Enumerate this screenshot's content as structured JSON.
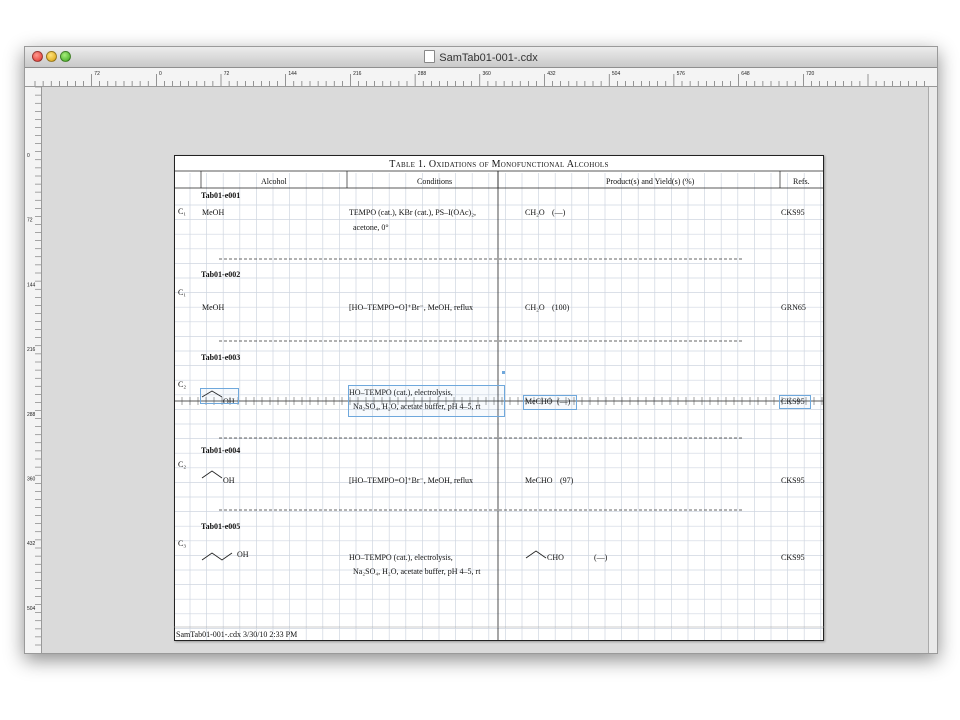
{
  "window": {
    "title": "SamTab01-001-.cdx",
    "doc_icon": "document-icon"
  },
  "rulers": {
    "horizontal_labels": [
      "72",
      "0",
      "72",
      "144",
      "216",
      "288",
      "360",
      "432",
      "504",
      "576",
      "648",
      "720"
    ],
    "vertical_labels": [
      "0",
      "72",
      "144",
      "216",
      "288",
      "360",
      "432",
      "504",
      "576"
    ]
  },
  "table": {
    "title": "Table 1. Oxidations of Monofunctional Alcohols",
    "headers": {
      "alcohol": "Alcohol",
      "conditions": "Conditions",
      "products": "Product(s) and Yield(s) (%)",
      "refs": "Refs."
    },
    "entries": [
      {
        "id": "Tab01-e001",
        "carbon": "C₁",
        "alcohol": "MeOH",
        "conditions": [
          "TEMPO (cat.), KBr (cat.), PS–I(OAc)₂,",
          "acetone, 0°"
        ],
        "product": "CH₂O",
        "yield": "(—)",
        "ref": "CKS95"
      },
      {
        "id": "Tab01-e002",
        "carbon": "C₁",
        "alcohol": "MeOH",
        "conditions": [
          "[HO–TEMPO=O]⁺Br⁻, MeOH, reflux"
        ],
        "product": "CH₂O",
        "yield": "(100)",
        "ref": "GRN65"
      },
      {
        "id": "Tab01-e003",
        "carbon": "C₂",
        "alcohol": "OH",
        "conditions": [
          "HO–TEMPO (cat.), electrolysis,",
          "Na₂SO₄, H₂O, acetate buffer, pH 4–5, rt"
        ],
        "product": "MeCHO",
        "yield": "(—)",
        "ref": "CKS95"
      },
      {
        "id": "Tab01-e004",
        "carbon": "C₂",
        "alcohol": "OH",
        "conditions": [
          "[HO–TEMPO=O]⁺Br⁻, MeOH, reflux"
        ],
        "product": "MeCHO",
        "yield": "(97)",
        "ref": "CKS95"
      },
      {
        "id": "Tab01-e005",
        "carbon": "C₃",
        "alcohol": "OH",
        "conditions": [
          "HO–TEMPO (cat.), electrolysis,",
          "Na₂SO₄, H₂O, acetate buffer, pH 4–5, rt"
        ],
        "product": "CHO",
        "yield": "(—)",
        "ref": "CKS95"
      }
    ],
    "footer": "SamTab01-001-.cdx 3/30/10 2:33 PM"
  },
  "colors": {
    "selection": "#6fa8dc",
    "grid": "#cfd6e0",
    "canvas": "#dadada"
  }
}
